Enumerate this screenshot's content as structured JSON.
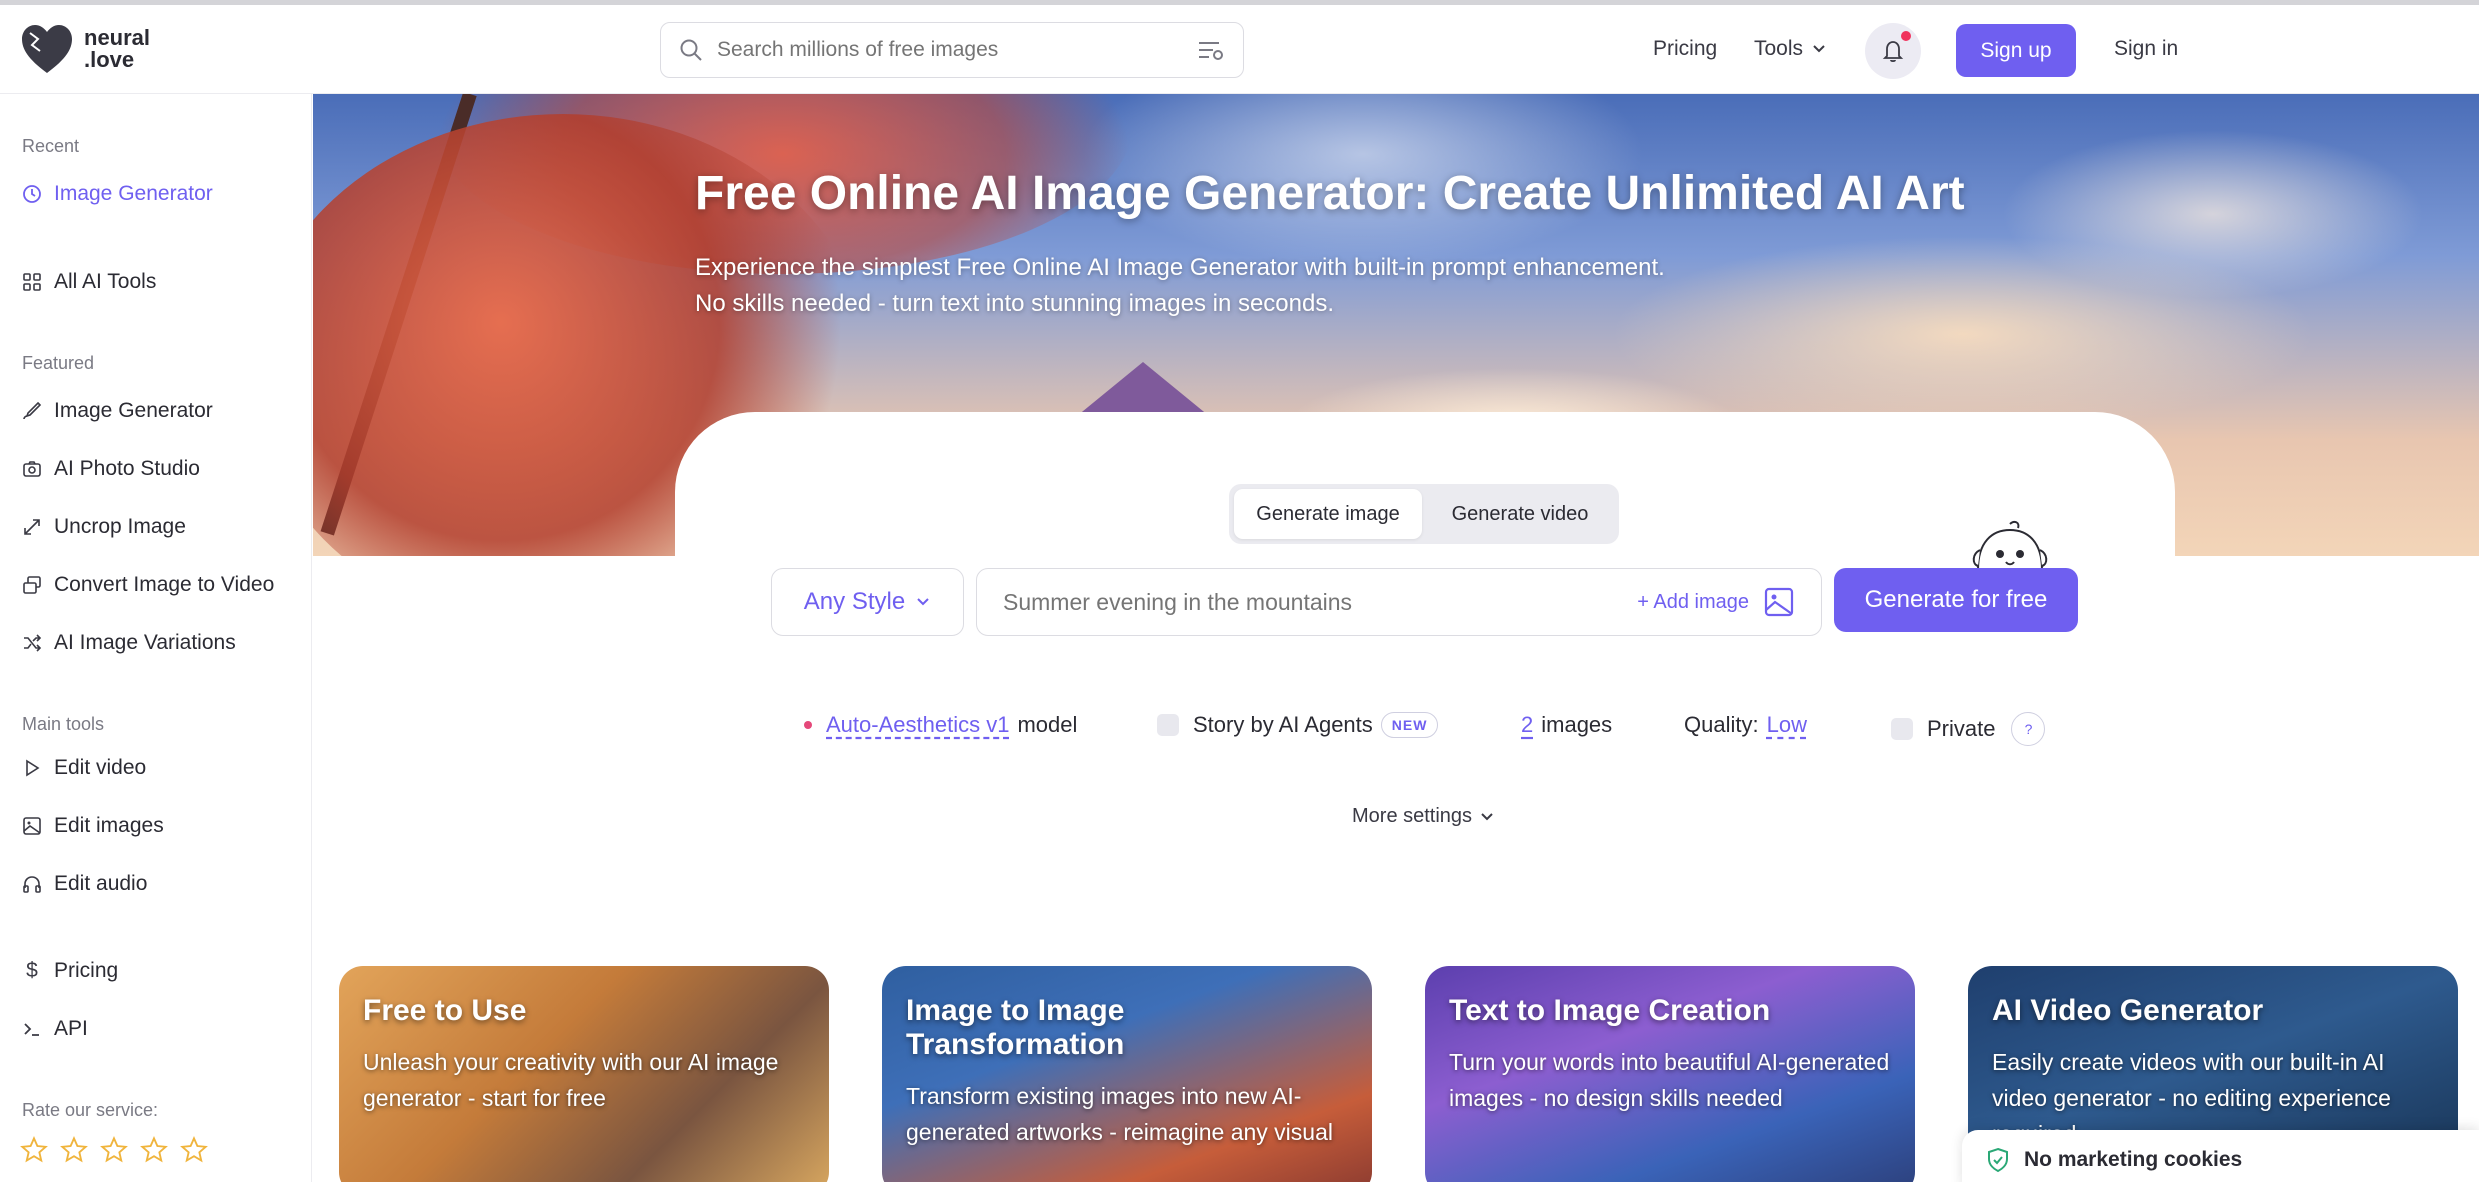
{
  "brand": {
    "name_line1": "neural",
    "name_line2": ".love"
  },
  "header": {
    "search_placeholder": "Search millions of free images",
    "pricing": "Pricing",
    "tools": "Tools",
    "sign_up": "Sign up",
    "sign_in": "Sign in"
  },
  "sidebar": {
    "recent_label": "Recent",
    "recent_item": "Image Generator",
    "all_tools": "All AI Tools",
    "featured_label": "Featured",
    "featured": [
      "Image Generator",
      "AI Photo Studio",
      "Uncrop Image",
      "Convert Image to Video",
      "AI Image Variations"
    ],
    "main_label": "Main tools",
    "main": [
      "Edit video",
      "Edit images",
      "Edit audio"
    ],
    "pricing": "Pricing",
    "api": "API",
    "rate_label": "Rate our service:",
    "star_count": 5
  },
  "hero": {
    "title": "Free Online AI Image Generator: Create Unlimited AI Art",
    "subtitle_line1": "Experience the simplest Free Online AI Image Generator with built-in prompt enhancement.",
    "subtitle_line2": "No skills needed - turn text into stunning images in seconds."
  },
  "generator": {
    "tab_image": "Generate image",
    "tab_video": "Generate video",
    "style": "Any Style",
    "prompt_placeholder": "Summer evening in the mountains",
    "add_image": "+ Add image",
    "generate": "Generate for free",
    "model_name": "Auto-Aesthetics v1",
    "model_suffix": "model",
    "story": "Story by AI Agents",
    "new_badge": "NEW",
    "image_count": "2",
    "images_label": "images",
    "quality_label": "Quality:",
    "quality_value": "Low",
    "private": "Private",
    "help": "?",
    "more_settings": "More settings"
  },
  "features": [
    {
      "title": "Free to Use",
      "text": "Unleash your creativity with our AI image generator - start for free"
    },
    {
      "title": "Image to Image Transformation",
      "text": "Transform existing images into new AI-generated artworks - reimagine any visual"
    },
    {
      "title": "Text to Image Creation",
      "text": "Turn your words into beautiful AI-generated images - no design skills needed"
    },
    {
      "title": "AI Video Generator",
      "text": "Easily create videos with our built-in AI video generator - no editing experience required"
    }
  ],
  "cookie": {
    "text": "No marketing cookies"
  },
  "colors": {
    "accent": "#6f5ff0",
    "notification": "#f0325c",
    "model_dot": "#e5487a"
  }
}
